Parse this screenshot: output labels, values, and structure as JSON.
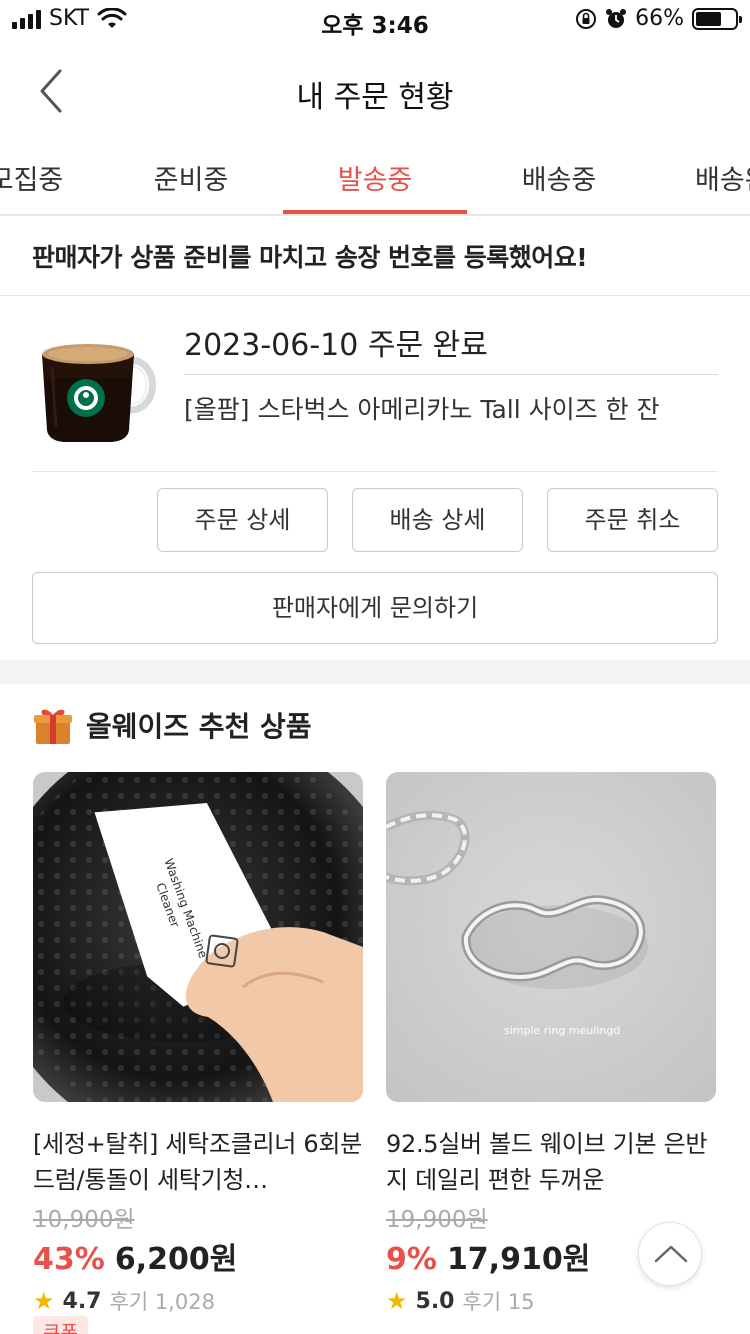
{
  "status_bar": {
    "carrier": "SKT",
    "time": "오후 3:46",
    "battery_percent": "66%",
    "battery_level": 0.66
  },
  "nav": {
    "title": "내 주문 현황"
  },
  "tabs": [
    {
      "label": "모집중"
    },
    {
      "label": "준비중"
    },
    {
      "label": "발송중"
    },
    {
      "label": "배송중"
    },
    {
      "label": "배송완료"
    }
  ],
  "active_tab": "발송중",
  "notice": {
    "text": "판매자가 상품 준비를 마치고 송장 번호를 등록했어요!"
  },
  "order": {
    "status": "2023-06-10 주문 완료",
    "product_name": "[올팜] 스타벅스 아메리카노 Tall 사이즈 한 잔",
    "buttons": {
      "detail": "주문 상세",
      "shipping": "배송 상세",
      "cancel": "주문 취소",
      "inquiry": "판매자에게 문의하기"
    }
  },
  "recommend": {
    "title": "올웨이즈 추천 상품",
    "products": [
      {
        "name": "[세정+탈취] 세탁조클리너 6회분 드럼/통돌이 세탁기청…",
        "original_price": "10,900원",
        "discount": "43%",
        "price": "6,200원",
        "rating": "4.7",
        "reviews": "후기 1,028",
        "packet_text_1": "Washing Machine",
        "packet_text_2": "Cleaner"
      },
      {
        "name": "92.5실버 볼드 웨이브 기본 은반지 데일리 편한 두꺼운",
        "original_price": "19,900원",
        "discount": "9%",
        "price": "17,910원",
        "rating": "5.0",
        "reviews": "후기 15",
        "image_caption": "simple ring meulingd"
      }
    ],
    "coupon_label": "쿠폰"
  },
  "colors": {
    "accent": "#e8504a",
    "star": "#f5b800"
  }
}
